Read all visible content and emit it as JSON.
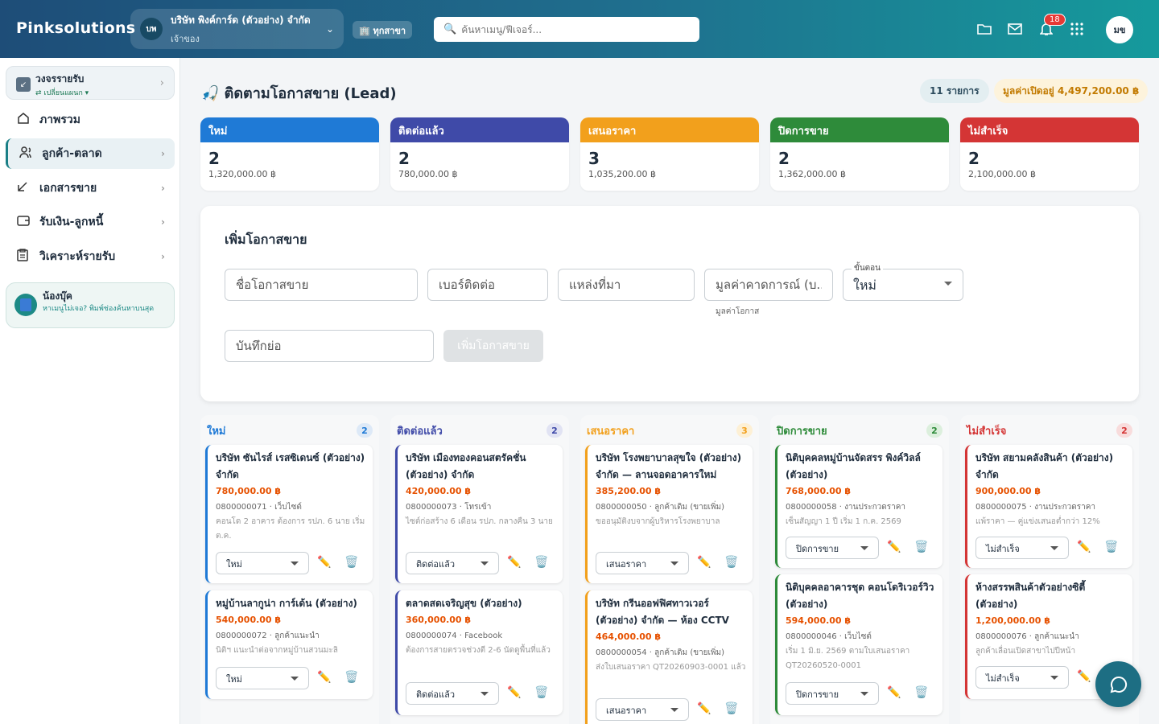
{
  "topbar": {
    "brand": "Pinksolutions",
    "company_initials": "บพ",
    "company_name": "บริษัท พิงค์การ์ด (ตัวอย่าง) จำกัด",
    "company_role": "เจ้าของ",
    "branch": "🏢 ทุกสาขา",
    "search_placeholder": "ค้นหาเมนู/ฟีเจอร์...",
    "notifications": "18",
    "user_initials": "มข"
  },
  "sidebar": {
    "plan_title": "วงจรรายรับ",
    "plan_sub": "⇄ เปลี่ยนแผนก ▾",
    "items": [
      {
        "label": "ภาพรวม",
        "icon": "home-icon"
      },
      {
        "label": "ลูกค้า-ตลาด",
        "icon": "users-icon"
      },
      {
        "label": "เอกสารขาย",
        "icon": "arrow-icon"
      },
      {
        "label": "รับเงิน-ลูกหนี้",
        "icon": "wallet-icon"
      },
      {
        "label": "วิเคราะห์รายรับ",
        "icon": "report-icon"
      }
    ],
    "helper_name": "น้องบุ๊ค",
    "helper_text": "หาเมนูไม่เจอ? พิมพ์ช่องค้นหาบนสุด"
  },
  "page": {
    "title": "🎣 ติดตามโอกาสขาย (Lead)",
    "count_pill": "11 รายการ",
    "value_pill": "มูลค่าเปิดอยู่ 4,497,200.00 ฿"
  },
  "stats": [
    {
      "label": "ใหม่",
      "count": "2",
      "value": "1,320,000.00 ฿",
      "color": "#1f7ad6"
    },
    {
      "label": "ติดต่อแล้ว",
      "count": "2",
      "value": "780,000.00 ฿",
      "color": "#3f4aa8"
    },
    {
      "label": "เสนอราคา",
      "count": "3",
      "value": "1,035,200.00 ฿",
      "color": "#f2a01c"
    },
    {
      "label": "ปิดการขาย",
      "count": "2",
      "value": "1,362,000.00 ฿",
      "color": "#2e8b3a"
    },
    {
      "label": "ไม่สำเร็จ",
      "count": "2",
      "value": "2,100,000.00 ฿",
      "color": "#d43535"
    }
  ],
  "form": {
    "title": "เพิ่มโอกาสขาย",
    "name_ph": "ชื่อโอกาสขาย",
    "phone_ph": "เบอร์ติดต่อ",
    "source_ph": "แหล่งที่มา",
    "value_ph": "มูลค่าคาดการณ์ (บ...",
    "value_hint": "มูลค่าโอกาส",
    "stage_label": "ขั้นตอน",
    "stage_value": "ใหม่",
    "note_ph": "บันทึกย่อ",
    "submit": "เพิ่มโอกาสขาย"
  },
  "columns": [
    {
      "title": "ใหม่",
      "count": "2",
      "color": "#1f7ad6",
      "badge_bg": "#dde9f7",
      "cards": [
        {
          "name": "บริษัท ซันไรส์ เรสซิเดนซ์ (ตัวอย่าง) จำกัด",
          "value": "780,000.00 ฿",
          "phone": "0800000071 · เว็บไซต์",
          "note": "คอนโด 2 อาคาร ต้องการ รปภ. 6 นาย เริ่ม ต.ค.",
          "stage": "ใหม่"
        },
        {
          "name": "หมู่บ้านลากูน่า การ์เด้น (ตัวอย่าง)",
          "value": "540,000.00 ฿",
          "phone": "0800000072 · ลูกค้าแนะนำ",
          "note": "นิติฯ แนะนำต่อจากหมู่บ้านสวนมะลิ",
          "stage": "ใหม่"
        }
      ]
    },
    {
      "title": "ติดต่อแล้ว",
      "count": "2",
      "color": "#3f4aa8",
      "badge_bg": "#e1e3f3",
      "cards": [
        {
          "name": "บริษัท เมืองทองคอนสตรัคชั่น (ตัวอย่าง) จำกัด",
          "value": "420,000.00 ฿",
          "phone": "0800000073 · โทรเข้า",
          "note": "ไซต์ก่อสร้าง 6 เดือน รปภ. กลางคืน 3 นาย",
          "stage": "ติดต่อแล้ว"
        },
        {
          "name": "ตลาดสดเจริญสุข (ตัวอย่าง)",
          "value": "360,000.00 ฿",
          "phone": "0800000074 · Facebook",
          "note": "ต้องการสายตรวจช่วงตี 2-6 นัดดูพื้นที่แล้ว",
          "stage": "ติดต่อแล้ว"
        }
      ]
    },
    {
      "title": "เสนอราคา",
      "count": "3",
      "color": "#f2a01c",
      "badge_bg": "#fdf0d5",
      "cards": [
        {
          "name": "บริษัท โรงพยาบาลสุขใจ (ตัวอย่าง) จำกัด — ลานจอดอาคารใหม่",
          "value": "385,200.00 ฿",
          "phone": "0800000050 · ลูกค้าเดิม (ขายเพิ่ม)",
          "note": "ขออนุมัติงบจากผู้บริหารโรงพยาบาล",
          "stage": "เสนอราคา"
        },
        {
          "name": "บริษัท กรีนออฟฟิศทาวเวอร์ (ตัวอย่าง) จำกัด — ห้อง CCTV",
          "value": "464,000.00 ฿",
          "phone": "0800000054 · ลูกค้าเดิม (ขายเพิ่ม)",
          "note": "ส่งใบเสนอราคา QT20260903-0001 แล้ว",
          "stage": "เสนอราคา"
        }
      ]
    },
    {
      "title": "ปิดการขาย",
      "count": "2",
      "color": "#2e8b3a",
      "badge_bg": "#dcefdd",
      "cards": [
        {
          "name": "นิติบุคคลหมู่บ้านจัดสรร พิงค์วิลล์ (ตัวอย่าง)",
          "value": "768,000.00 ฿",
          "phone": "0800000058 · งานประกวดราคา",
          "note": "เซ็นสัญญา 1 ปี เริ่ม 1 ก.ค. 2569",
          "stage": "ปิดการขาย"
        },
        {
          "name": "นิติบุคคลอาคารชุด คอนโดริเวอร์วิว (ตัวอย่าง)",
          "value": "594,000.00 ฿",
          "phone": "0800000046 · เว็บไซต์",
          "note": "เริ่ม 1 มิ.ย. 2569 ตามใบเสนอราคา QT20260520-0001",
          "stage": "ปิดการขาย"
        }
      ]
    },
    {
      "title": "ไม่สำเร็จ",
      "count": "2",
      "color": "#d43535",
      "badge_bg": "#f8dcdc",
      "cards": [
        {
          "name": "บริษัท สยามคลังสินค้า (ตัวอย่าง) จำกัด",
          "value": "900,000.00 ฿",
          "phone": "0800000075 · งานประกวดราคา",
          "note": "แพ้ราคา — คู่แข่งเสนอต่ำกว่า 12%",
          "stage": "ไม่สำเร็จ"
        },
        {
          "name": "ห้างสรรพสินค้าตัวอย่างซิตี้ (ตัวอย่าง)",
          "value": "1,200,000.00 ฿",
          "phone": "0800000076 · ลูกค้าแนะนำ",
          "note": "ลูกค้าเลื่อนเปิดสาขาไปปีหน้า",
          "stage": "ไม่สำเร็จ"
        }
      ]
    }
  ]
}
